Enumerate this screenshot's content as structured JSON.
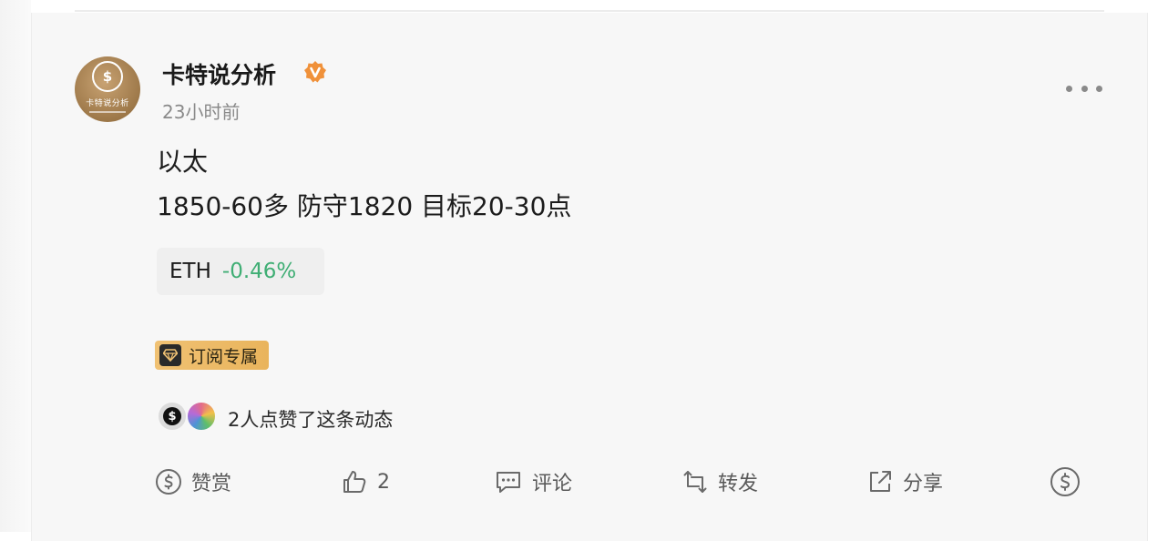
{
  "author": {
    "name": "卡特说分析",
    "avatar_monogram": "$",
    "avatar_caption": "卡特说分析",
    "verified_icon": "verified-badge-icon",
    "verified_color": "#f0913a",
    "posted_ago": "23小时前"
  },
  "post": {
    "lines": [
      "以太",
      "1850-60多 防守1820 目标20-30点"
    ],
    "ticker": {
      "symbol": "ETH",
      "change": "-0.46%",
      "change_color": "#3fae74"
    },
    "badge": {
      "label": "订阅专属",
      "icon": "diamond-icon"
    }
  },
  "likes": {
    "text": "2人点赞了这条动态",
    "avatars": [
      {
        "name": "liker-avatar-1",
        "glyph": "$"
      },
      {
        "name": "liker-avatar-2",
        "glyph": ""
      }
    ]
  },
  "actions": {
    "tip": {
      "label": "赞赏",
      "icon": "tip-coin-icon"
    },
    "like": {
      "label": "2",
      "icon": "thumbs-up-icon"
    },
    "comment": {
      "label": "评论",
      "icon": "comment-icon"
    },
    "repost": {
      "label": "转发",
      "icon": "repost-icon"
    },
    "share": {
      "label": "分享",
      "icon": "share-icon"
    },
    "coin": {
      "icon": "dollar-coin-icon"
    }
  }
}
